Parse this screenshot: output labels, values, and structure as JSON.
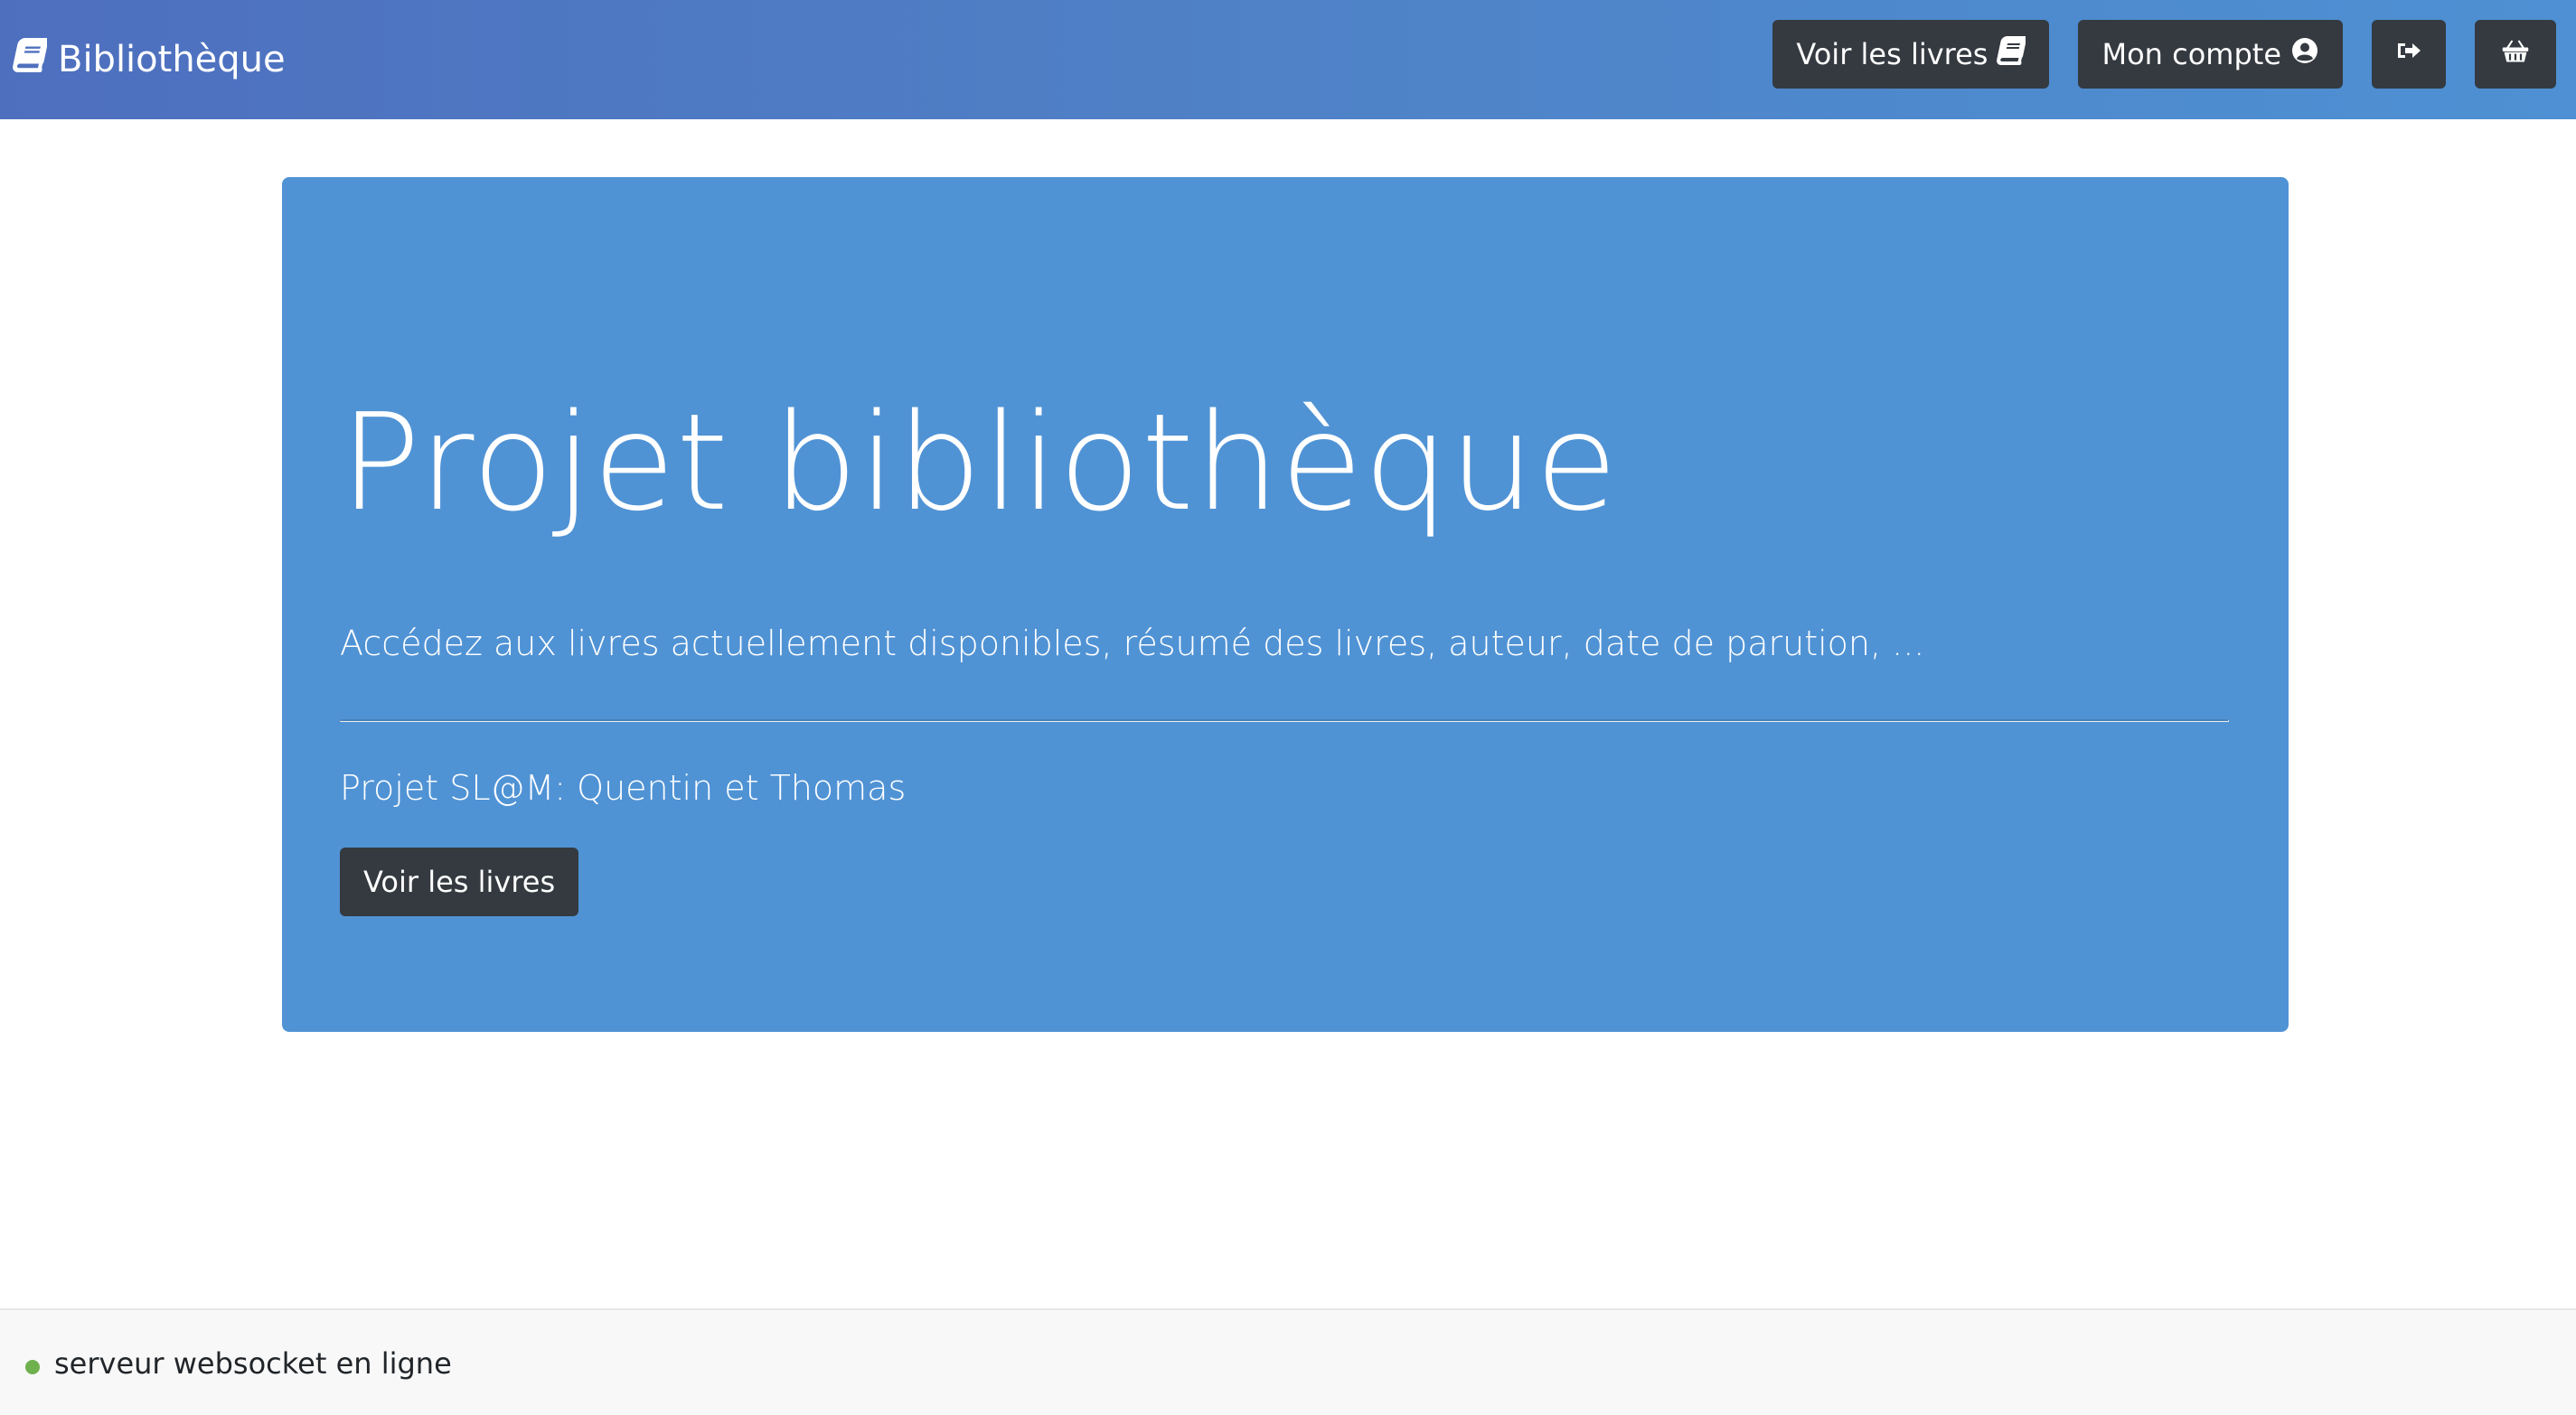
{
  "navbar": {
    "brand_label": "Bibliothèque",
    "brand_icon": "book-icon",
    "buttons": {
      "books_label": "Voir les livres",
      "books_icon": "book-icon",
      "account_label": "Mon compte",
      "account_icon": "user-circle-icon",
      "logout_icon": "sign-out-icon",
      "cart_icon": "basket-icon"
    }
  },
  "jumbotron": {
    "title": "Projet bibliothèque",
    "lead": "Accédez aux livres actuellement disponibles, résumé des livres, auteur, date de parution, ...",
    "authors": "Projet SL@M: Quentin et Thomas",
    "button_label": "Voir les livres"
  },
  "footer": {
    "status_text": "serveur websocket en ligne",
    "status_color": "#6fb04f"
  },
  "colors": {
    "navbar_gradient_start": "#4e6fbe",
    "navbar_gradient_end": "#4e90d3",
    "jumbotron_bg": "#5093d5",
    "button_dark": "#343a40"
  }
}
